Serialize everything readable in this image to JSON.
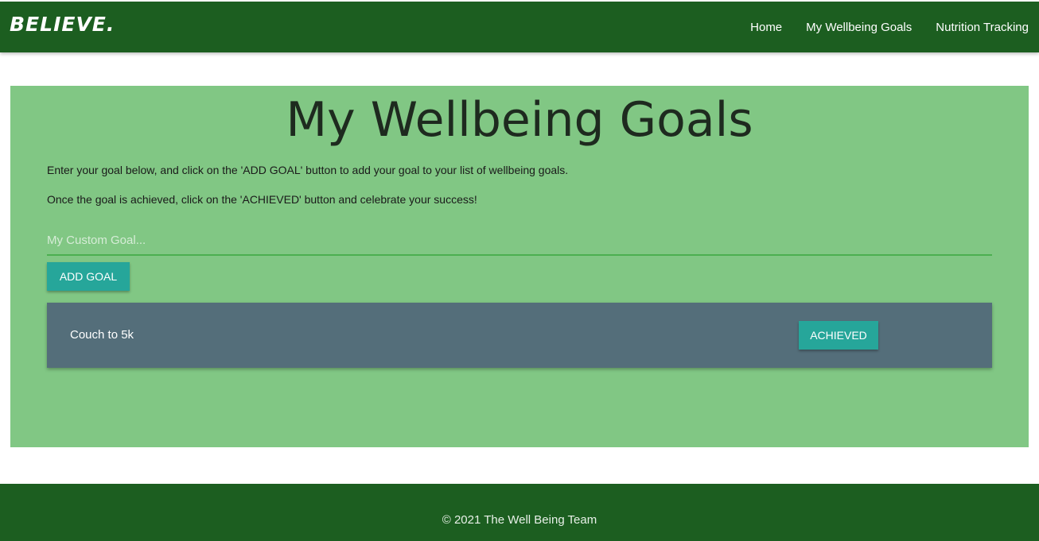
{
  "navbar": {
    "brand": "BELIEVE.",
    "links": [
      "Home",
      "My Wellbeing Goals",
      "Nutrition Tracking"
    ]
  },
  "main": {
    "title": "My Wellbeing Goals",
    "instruction_1": "Enter your goal below, and click on the 'ADD GOAL' button to add your goal to your list of wellbeing goals.",
    "instruction_2": "Once the goal is achieved, click on the 'ACHIEVED' button and celebrate your success!",
    "goal_input": {
      "value": "",
      "placeholder": "My Custom Goal..."
    },
    "add_button_label": "ADD GOAL",
    "goals": [
      {
        "text": "Couch to 5k",
        "button_label": "ACHIEVED"
      }
    ]
  },
  "footer": {
    "text": "© 2021 The Well Being Team"
  },
  "colors": {
    "navbar": "#1c5e20",
    "panel": "#81c784",
    "button": "#26a69a",
    "goal_card": "#546e7a",
    "input_underline": "#4caf50"
  }
}
